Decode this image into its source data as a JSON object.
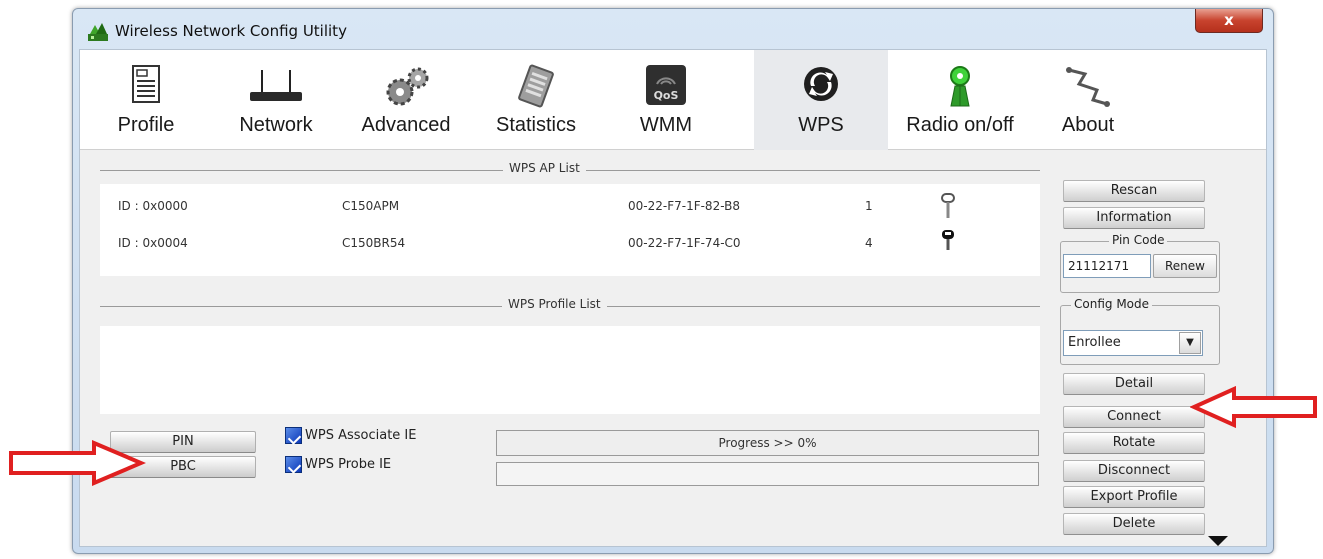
{
  "window": {
    "title": "Wireless Network Config Utility",
    "close_label": "x"
  },
  "toolbar": {
    "tabs": [
      {
        "label": "Profile",
        "icon": "profile-icon"
      },
      {
        "label": "Network",
        "icon": "router-icon"
      },
      {
        "label": "Advanced",
        "icon": "gears-icon"
      },
      {
        "label": "Statistics",
        "icon": "statistics-icon"
      },
      {
        "label": "WMM",
        "icon": "wmm-qos-icon",
        "badge": "QoS"
      },
      {
        "label": "WPS",
        "icon": "wps-icon",
        "active": true
      },
      {
        "label": "Radio on/off",
        "icon": "radio-icon"
      },
      {
        "label": "About",
        "icon": "about-icon"
      }
    ]
  },
  "wps_ap_list": {
    "title": "WPS AP List",
    "rows": [
      {
        "id": "ID : 0x0000",
        "ssid": "C150APM",
        "bssid": "00-22-F7-1F-82-B8",
        "channel": "1",
        "icon": "key-icon"
      },
      {
        "id": "ID : 0x0004",
        "ssid": "C150BR54",
        "bssid": "00-22-F7-1F-74-C0",
        "channel": "4",
        "icon": "lock-key-icon"
      }
    ]
  },
  "wps_profile_list": {
    "title": "WPS Profile List"
  },
  "side_buttons": {
    "rescan": "Rescan",
    "information": "Information",
    "pin_code_legend": "Pin Code",
    "pin_code_value": "21112171",
    "renew": "Renew",
    "config_mode_legend": "Config Mode",
    "config_mode_value": "Enrollee",
    "detail": "Detail",
    "connect": "Connect",
    "rotate": "Rotate",
    "disconnect": "Disconnect",
    "export_profile": "Export Profile",
    "delete": "Delete"
  },
  "bottom": {
    "pin_button": "PIN",
    "pbc_button": "PBC",
    "wps_associate_ie": "WPS Associate IE",
    "wps_probe_ie": "WPS Probe IE",
    "progress_text": "Progress >> 0%",
    "progress_value": 0
  },
  "colors": {
    "annotation_arrow": "#e02020",
    "checkbox": "#1448c8"
  }
}
